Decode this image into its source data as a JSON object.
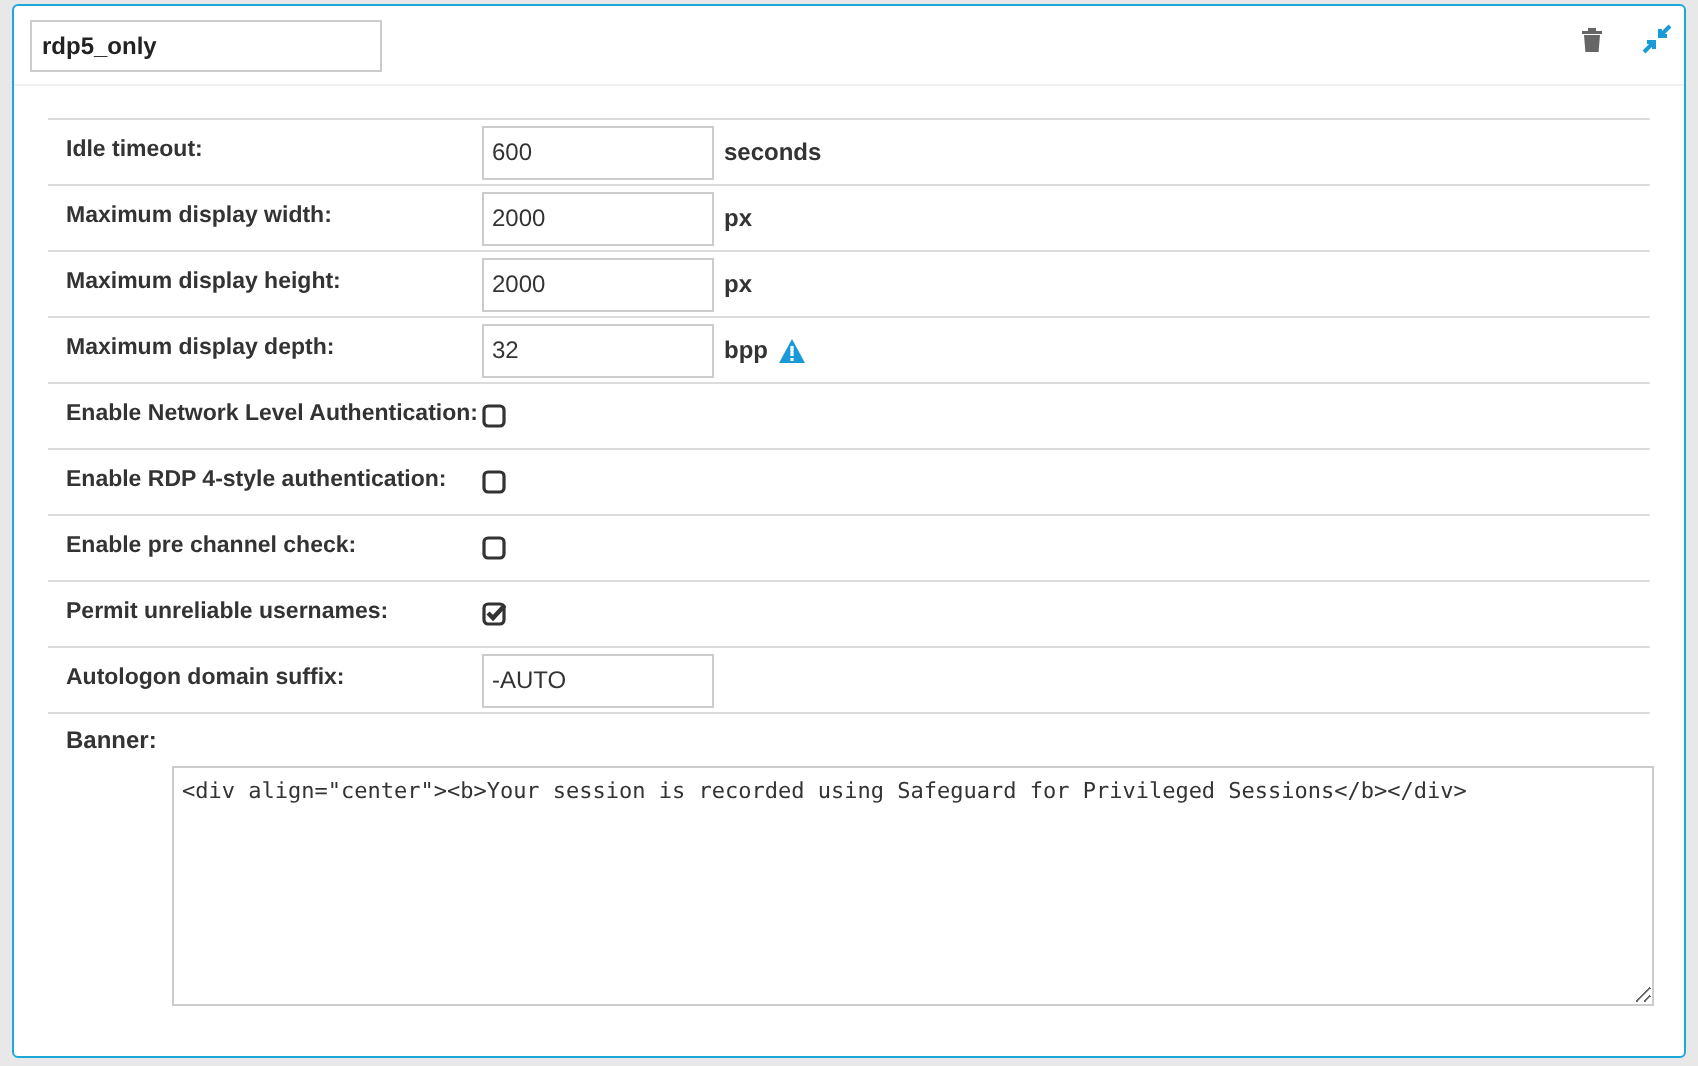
{
  "name_field": {
    "value": "rdp5_only"
  },
  "rows": [
    {
      "kind": "text",
      "label": "Idle timeout:",
      "value": "600",
      "unit": "seconds"
    },
    {
      "kind": "text",
      "label": "Maximum display width:",
      "value": "2000",
      "unit": "px"
    },
    {
      "kind": "text",
      "label": "Maximum display height:",
      "value": "2000",
      "unit": "px"
    },
    {
      "kind": "text",
      "label": "Maximum display depth:",
      "value": "32",
      "unit": "bpp",
      "warning": true
    },
    {
      "kind": "checkbox",
      "label": "Enable Network Level Authentication:",
      "checked": false
    },
    {
      "kind": "checkbox",
      "label": "Enable RDP 4-style authentication:",
      "checked": false
    },
    {
      "kind": "checkbox",
      "label": "Enable pre channel check:",
      "checked": false
    },
    {
      "kind": "checkbox",
      "label": "Permit unreliable usernames:",
      "checked": true
    },
    {
      "kind": "text",
      "label": "Autologon domain suffix:",
      "value": "-AUTO"
    }
  ],
  "banner": {
    "label": "Banner:",
    "value": "<div align=\"center\"><b>Your session is recorded using Safeguard for Privileged Sessions</b></div>"
  }
}
